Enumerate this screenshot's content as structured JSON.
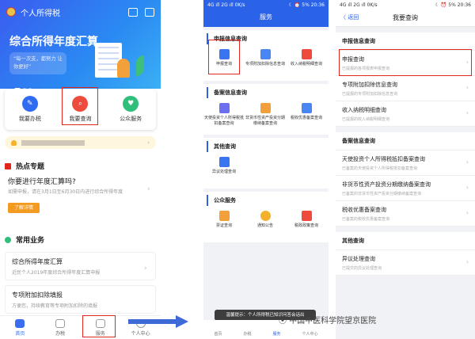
{
  "panel1": {
    "app_title": "个人所得税",
    "banner_title": "综合所得年度汇算",
    "banner_bubble": "“每一次支，都努力 让你更好”",
    "actions": [
      {
        "label": "我要办税",
        "color": "#2f6cf1"
      },
      {
        "label": "我要查询",
        "color": "#ef4b3c"
      },
      {
        "label": "公众服务",
        "color": "#2fbf7b"
      }
    ],
    "hot_section": "热点专题",
    "hot_title": "你要进行年度汇算吗?",
    "hot_sub": "如需申报，请在3月1日至6月30日内进行综合所得年度",
    "hot_button": "了解详情",
    "biz_section": "常用业务",
    "biz_items": [
      {
        "title": "综合所得年度汇算",
        "sub": "近民个人2019年度综合所得年度汇算申报"
      },
      {
        "title": "专项附加扣除填报",
        "sub": "方便您，持续教育等专项附加扣除的填报"
      }
    ],
    "tabs": [
      "首页",
      "办税",
      "服务",
      "个人中心"
    ]
  },
  "panel2": {
    "status_left": "4G ıll 2G ıll  0K/s",
    "status_right": "☾ ⏰ 5%  20:36",
    "title": "服务",
    "groups": [
      {
        "title": "申报信息查询",
        "items": [
          "申报查询",
          "专项附加扣除信息查询",
          "收入纳税明细查询"
        ]
      },
      {
        "title": "备案信息查询",
        "items": [
          "天使投资个人所得税抵扣备案查询",
          "非货币性资产投资分期缴纳备案查询",
          "税收优惠备案查询"
        ]
      },
      {
        "title": "其他查询",
        "items": [
          "异议处理查询"
        ]
      },
      {
        "title": "公众服务",
        "items": [
          "票证查询",
          "通知公告",
          "税政政策查询"
        ]
      }
    ],
    "toast": "温馨提示：个人所得税已知识问答会话出",
    "tabs": [
      "首页",
      "办税",
      "服务",
      "个人中心"
    ]
  },
  "panel3": {
    "status_left": "4G ıll 2G ıll  0K/s",
    "status_right": "☾ ⏰ 5%  20:36",
    "back": "〈 返回",
    "title": "我要查询",
    "sections": [
      {
        "title": "申报信息查询",
        "items": [
          {
            "title": "申报查询",
            "sub": "已提报的各项报表申报查询"
          },
          {
            "title": "专项附加扣除信息查询",
            "sub": "已提报的专项附加扣除信息查询"
          },
          {
            "title": "收入纳税明细查询",
            "sub": "已提报的收入纳税明细查询"
          }
        ]
      },
      {
        "title": "备案信息查询",
        "items": [
          {
            "title": "天使投资个人所得税抵扣备案查询",
            "sub": "已备案的天使投资个人所得税抵扣备案查询"
          },
          {
            "title": "非货币性资产投资分期缴纳备案查询",
            "sub": "已备案的非货币性资产投资分期缴纳备案查询"
          },
          {
            "title": "税收优惠备案查询",
            "sub": "已备案的税收优惠备案查询"
          }
        ]
      },
      {
        "title": "其他查询",
        "items": [
          {
            "title": "异议处理查询",
            "sub": "已提交的异议处理查询"
          }
        ]
      }
    ]
  },
  "watermark": "中国中医科学院望京医院",
  "colors": {
    "primary": "#2b63e8",
    "highlight": "#e0261f",
    "accent": "#f39a20"
  }
}
